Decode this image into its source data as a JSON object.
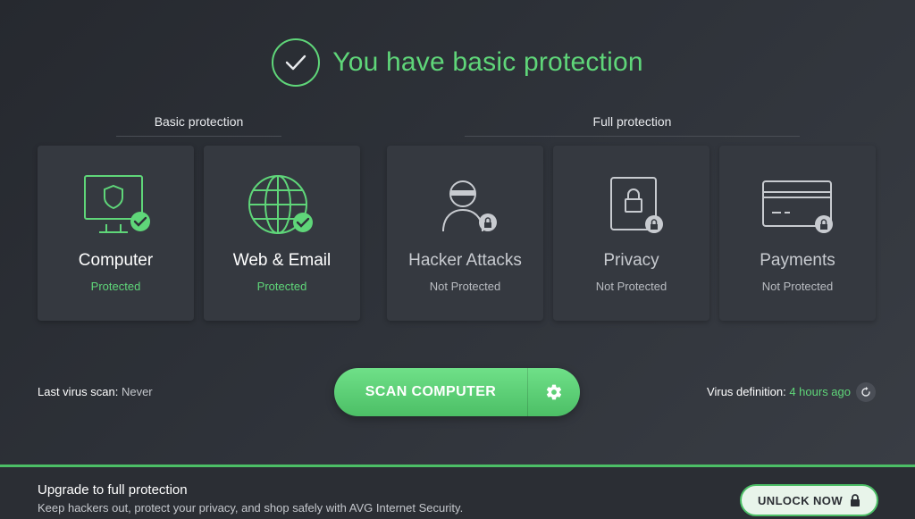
{
  "header": {
    "title": "You have basic protection"
  },
  "sections": {
    "basic_label": "Basic protection",
    "full_label": "Full protection"
  },
  "cards": [
    {
      "title": "Computer",
      "status": "Protected",
      "icon": "monitor-shield-icon"
    },
    {
      "title": "Web & Email",
      "status": "Protected",
      "icon": "globe-icon"
    },
    {
      "title": "Hacker Attacks",
      "status": "Not Protected",
      "icon": "hacker-icon"
    },
    {
      "title": "Privacy",
      "status": "Not Protected",
      "icon": "privacy-lock-icon"
    },
    {
      "title": "Payments",
      "status": "Not Protected",
      "icon": "credit-card-icon"
    }
  ],
  "scan": {
    "last_label": "Last virus scan:",
    "last_value": "Never",
    "button_label": "SCAN COMPUTER"
  },
  "virus_def": {
    "label": "Virus definition:",
    "value": "4 hours ago"
  },
  "footer": {
    "title": "Upgrade to full protection",
    "description": "Keep hackers out, protect your privacy, and shop safely with AVG Internet Security.",
    "unlock_label": "UNLOCK NOW"
  },
  "colors": {
    "accent": "#5fd679",
    "background": "#2e3239",
    "card": "#353940"
  }
}
